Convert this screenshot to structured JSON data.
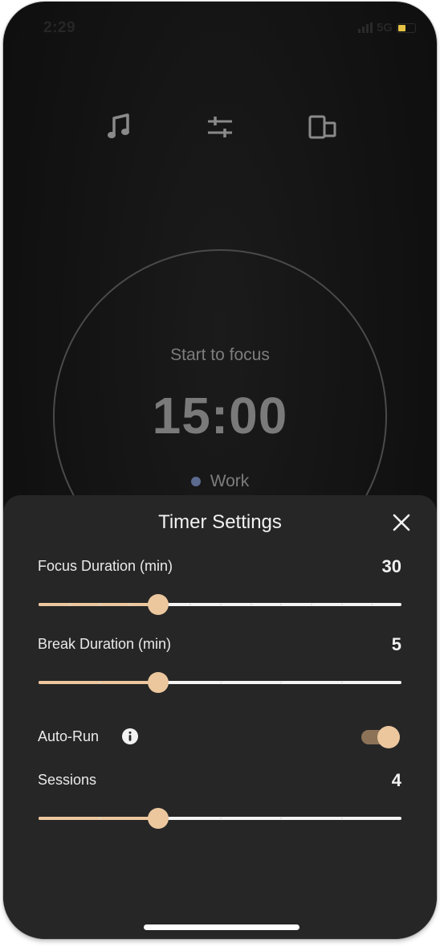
{
  "status_bar": {
    "time": "2:29",
    "network": "5G"
  },
  "top_icons": [
    "music-note-icon",
    "sliders-icon",
    "devices-icon"
  ],
  "timer": {
    "prompt": "Start to focus",
    "time": "15:00",
    "mode": "Work",
    "mode_color": "#5b6a8f"
  },
  "settings": {
    "title": "Timer Settings",
    "focus": {
      "label": "Focus Duration (min)",
      "value": "30",
      "fraction": 0.33
    },
    "break": {
      "label": "Break Duration (min)",
      "value": "5",
      "fraction": 0.33
    },
    "auto_run": {
      "label": "Auto-Run",
      "enabled": true
    },
    "sessions": {
      "label": "Sessions",
      "value": "4",
      "fraction": 0.33
    }
  },
  "colors": {
    "accent": "#ecc79e",
    "sheet": "#262626",
    "toggle_track": "#8c7357"
  }
}
